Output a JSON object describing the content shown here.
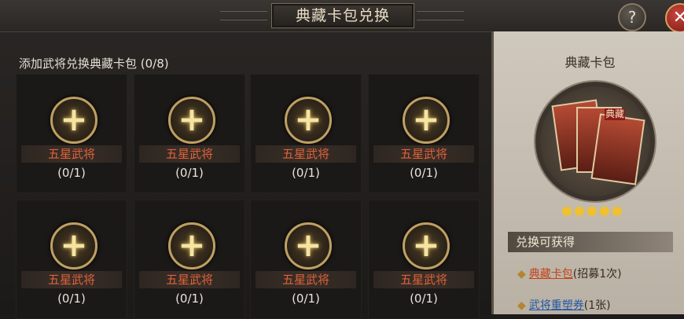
{
  "window": {
    "title": "典藏卡包兑换"
  },
  "header": {
    "help_label": "?",
    "close_label": "✕"
  },
  "main": {
    "subtitle": "添加武将兑换典藏卡包 (0/8)",
    "slots": [
      {
        "name": "五星武将",
        "count": "(0/1)"
      },
      {
        "name": "五星武将",
        "count": "(0/1)"
      },
      {
        "name": "五星武将",
        "count": "(0/1)"
      },
      {
        "name": "五星武将",
        "count": "(0/1)"
      },
      {
        "name": "五星武将",
        "count": "(0/1)"
      },
      {
        "name": "五星武将",
        "count": "(0/1)"
      },
      {
        "name": "五星武将",
        "count": "(0/1)"
      },
      {
        "name": "五星武将",
        "count": "(0/1)"
      }
    ]
  },
  "panel": {
    "pack_title": "典藏卡包",
    "card_label": "典藏",
    "stars": "●●●●●",
    "gain_title": "兑换可获得",
    "rewards": [
      {
        "name": "典藏卡包",
        "detail": "(招募1次)"
      },
      {
        "name": "武将重塑券",
        "detail": "(1张)"
      }
    ]
  }
}
